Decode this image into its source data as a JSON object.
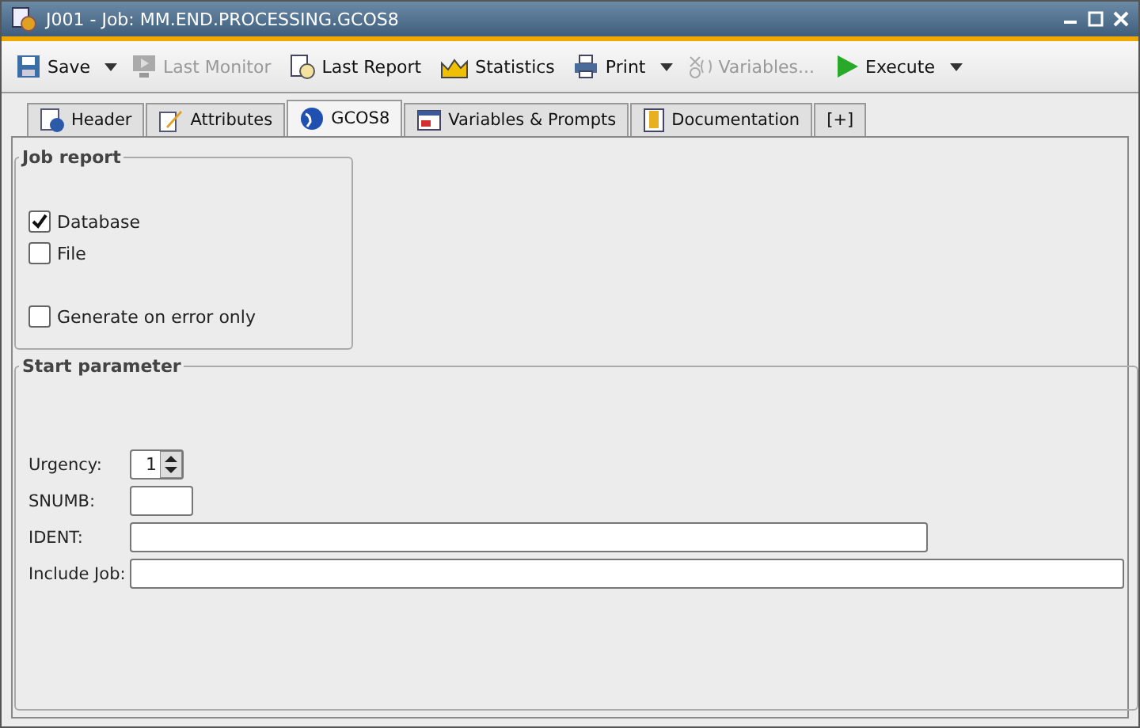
{
  "window": {
    "title": "J001 - Job: MM.END.PROCESSING.GCOS8"
  },
  "toolbar": [
    {
      "label": "Save",
      "disabled": false,
      "dropdown": true
    },
    {
      "label": "Last Monitor",
      "disabled": true,
      "dropdown": false
    },
    {
      "label": "Last Report",
      "disabled": false,
      "dropdown": false
    },
    {
      "label": "Statistics",
      "disabled": false,
      "dropdown": false
    },
    {
      "label": "Print",
      "disabled": false,
      "dropdown": true
    },
    {
      "label": "Variables...",
      "disabled": true,
      "dropdown": false
    },
    {
      "label": "Execute",
      "disabled": false,
      "dropdown": true
    }
  ],
  "tabs": [
    {
      "label": "Header",
      "selected": false
    },
    {
      "label": "Attributes",
      "selected": false
    },
    {
      "label": "GCOS8",
      "selected": true
    },
    {
      "label": "Variables & Prompts",
      "selected": false
    },
    {
      "label": "Documentation",
      "selected": false
    },
    {
      "label": "[+]",
      "selected": false
    }
  ],
  "job_report": {
    "title": "Job report",
    "options": [
      {
        "label": "Database",
        "checked": true
      },
      {
        "label": "File",
        "checked": false
      },
      {
        "label": "Generate on error only",
        "checked": false
      }
    ]
  },
  "start_parameter": {
    "title": "Start parameter",
    "fields": [
      {
        "label": "Urgency:",
        "kind": "spinner",
        "value": "1"
      },
      {
        "label": "SNUMB:",
        "kind": "short"
      },
      {
        "label": "IDENT:",
        "kind": "medium"
      },
      {
        "label": "Include Job:",
        "kind": "long"
      }
    ]
  }
}
